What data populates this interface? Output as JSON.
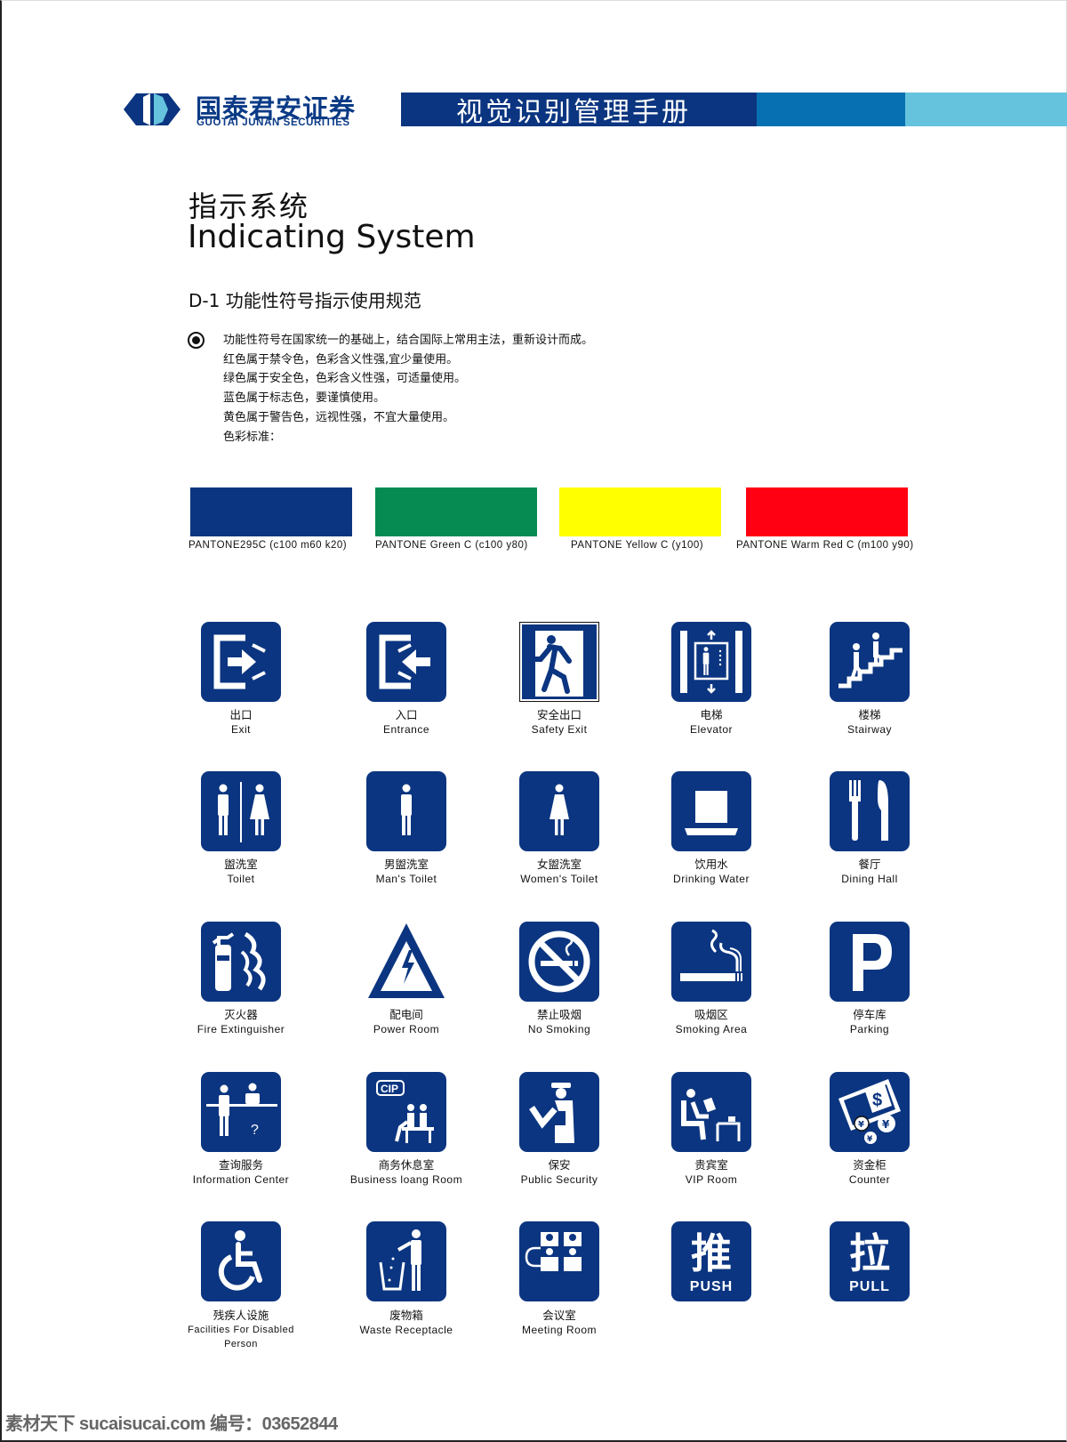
{
  "header": {
    "company_cn": "国泰君安证券",
    "company_en": "GUOTAI JUNAN SECURITIES",
    "manual_title": "视觉识别管理手册",
    "band_colors": [
      "#0b3580",
      "#0770b2",
      "#66c3dd"
    ]
  },
  "page": {
    "title_cn": "指示系统",
    "title_en": "Indicating System",
    "section_title": "D-1  功能性符号指示使用规范",
    "description": [
      "功能性符号在国家统一的基础上，结合国际上常用主法，重新设计而成。",
      "红色属于禁令色，色彩含义性强,宜少量使用。",
      "绿色属于安全色，色彩含义性强，可适量使用。",
      "蓝色属于标志色，要谨慎使用。",
      "黄色属于警告色，远视性强，不宜大量使用。",
      "色彩标准："
    ]
  },
  "swatches": [
    {
      "label": "PANTONE295C  (c100  m60  k20)",
      "color": "#0b3580"
    },
    {
      "label": "PANTONE  Green  C  (c100  y80)",
      "color": "#068c53"
    },
    {
      "label": "PANTONE  Yellow  C  (y100)",
      "color": "#ffff00"
    },
    {
      "label": "PANTONE  Warm  Red  C  (m100  y90)",
      "color": "#ff0012"
    }
  ],
  "sign_color": "#0b3580",
  "signs": [
    {
      "icon": "exit-icon",
      "cn": "出口",
      "en": "Exit"
    },
    {
      "icon": "entrance-icon",
      "cn": "入口",
      "en": "Entrance"
    },
    {
      "icon": "safety-exit-icon",
      "cn": "安全出口",
      "en": "Safety  Exit"
    },
    {
      "icon": "elevator-icon",
      "cn": "电梯",
      "en": "Elevator"
    },
    {
      "icon": "stairway-icon",
      "cn": "楼梯",
      "en": "Stairway"
    },
    {
      "icon": "toilet-icon",
      "cn": "盥洗室",
      "en": "Toilet"
    },
    {
      "icon": "mens-toilet-icon",
      "cn": "男盥洗室",
      "en": "Man's  Toilet"
    },
    {
      "icon": "womens-toilet-icon",
      "cn": "女盥洗室",
      "en": "Women's  Toilet"
    },
    {
      "icon": "drinking-water-icon",
      "cn": "饮用水",
      "en": "Drinking  Water"
    },
    {
      "icon": "dining-hall-icon",
      "cn": "餐厅",
      "en": "Dining  Hall"
    },
    {
      "icon": "fire-extinguisher-icon",
      "cn": "灭火器",
      "en": "Fire  Extinguisher"
    },
    {
      "icon": "power-room-icon",
      "cn": "配电间",
      "en": "Power  Room"
    },
    {
      "icon": "no-smoking-icon",
      "cn": "禁止吸烟",
      "en": "No  Smoking"
    },
    {
      "icon": "smoking-area-icon",
      "cn": "吸烟区",
      "en": "Smoking  Area"
    },
    {
      "icon": "parking-icon",
      "cn": "停车库",
      "en": "Parking"
    },
    {
      "icon": "information-center-icon",
      "cn": "查询服务",
      "en": "Information  Center"
    },
    {
      "icon": "business-lounge-icon",
      "cn": "商务休息室",
      "en": "Business  loang  Room",
      "badge": "CIP"
    },
    {
      "icon": "public-security-icon",
      "cn": "保安",
      "en": "Public  Security"
    },
    {
      "icon": "vip-room-icon",
      "cn": "贵宾室",
      "en": "VIP  Room"
    },
    {
      "icon": "counter-icon",
      "cn": "资金柜",
      "en": "Counter"
    },
    {
      "icon": "disabled-facilities-icon",
      "cn": "残疾人设施",
      "en": "Facilities For Disabled Person"
    },
    {
      "icon": "waste-receptacle-icon",
      "cn": "废物箱",
      "en": "Waste  Receptacle"
    },
    {
      "icon": "meeting-room-icon",
      "cn": "会议室",
      "en": "Meeting   Room"
    },
    {
      "icon": "push-icon",
      "cn": "",
      "en": "",
      "glyph": "推",
      "word": "PUSH"
    },
    {
      "icon": "pull-icon",
      "cn": "",
      "en": "",
      "glyph": "拉",
      "word": "PULL"
    }
  ],
  "watermark": "素材天下 sucaisucai.com  编号：03652844"
}
